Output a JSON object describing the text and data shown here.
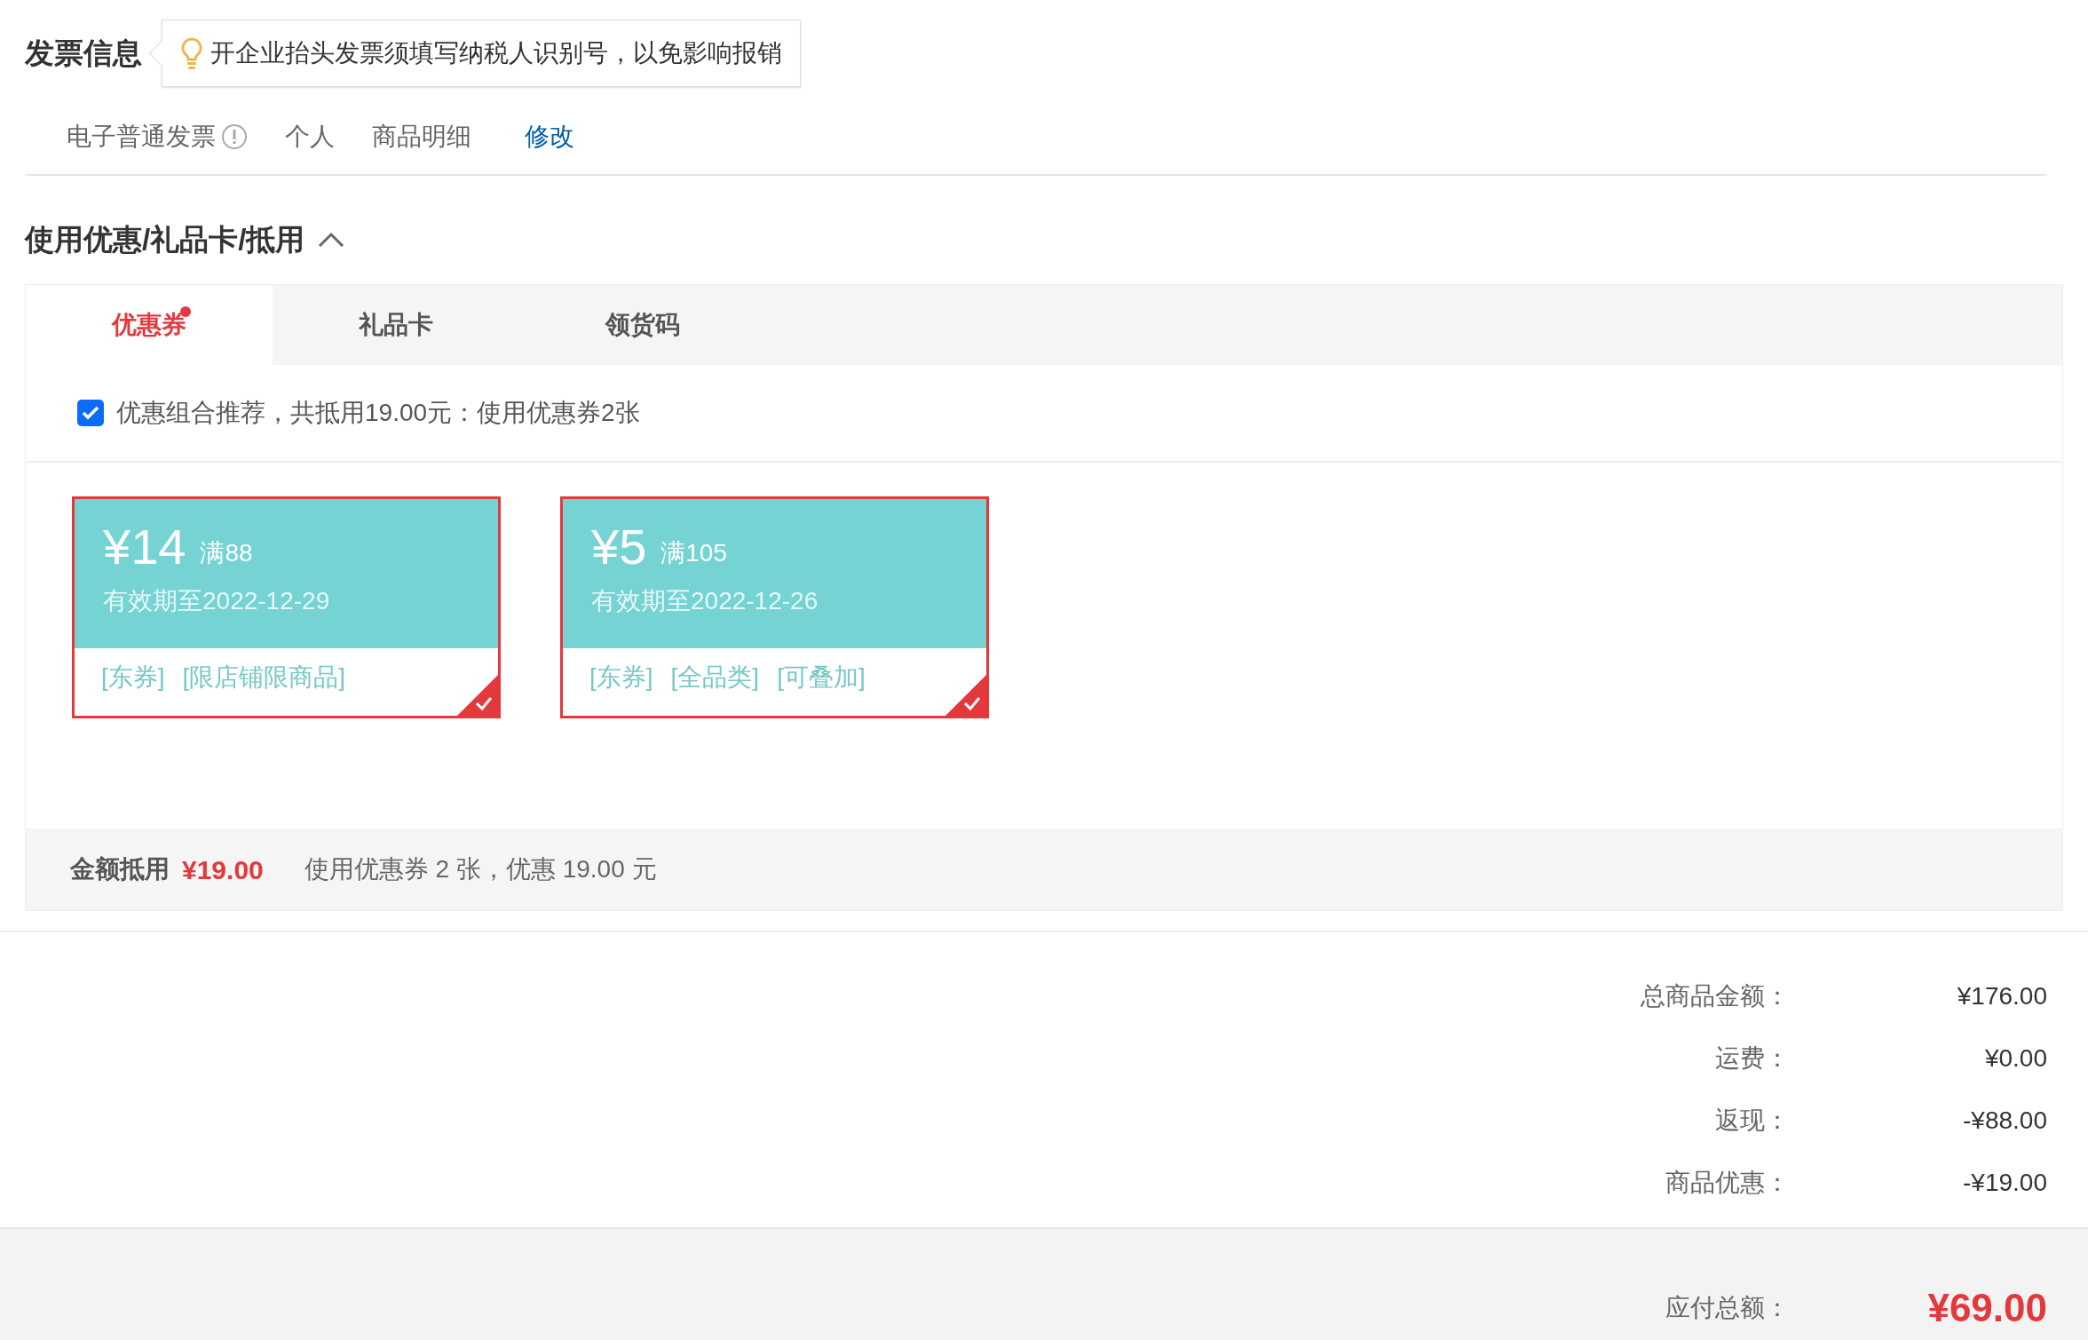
{
  "invoice": {
    "title": "发票信息",
    "tip": "开企业抬头发票须填写纳税人识别号，以免影响报销",
    "items": [
      {
        "kind": "info",
        "text": "电子普通发票"
      },
      {
        "kind": "plain",
        "text": "个人"
      },
      {
        "kind": "plain",
        "text": "商品明细"
      }
    ],
    "edit_link": "修改"
  },
  "discount": {
    "title": "使用优惠/礼品卡/抵用",
    "expanded": true,
    "tabs": [
      {
        "label": "优惠券",
        "selected": true,
        "dot": true
      },
      {
        "label": "礼品卡",
        "selected": false,
        "dot": false
      },
      {
        "label": "领货码",
        "selected": false,
        "dot": false
      }
    ],
    "recommend": {
      "checked": true,
      "text": "优惠组合推荐，共抵用19.00元：使用优惠券2张"
    },
    "coupons": [
      {
        "amount": "¥14",
        "condition": "满88",
        "validity": "有效期至2022-12-29",
        "tags": [
          "[东券]",
          "[限店铺限商品]"
        ],
        "selected": true
      },
      {
        "amount": "¥5",
        "condition": "满105",
        "validity": "有效期至2022-12-26",
        "tags": [
          "[东券]",
          "[全品类]",
          "[可叠加]"
        ],
        "selected": true
      }
    ],
    "footer": {
      "label": "金额抵用",
      "amount": "¥19.00",
      "note": "使用优惠券 2 张，优惠 19.00 元"
    }
  },
  "summary": {
    "rows": [
      {
        "label": "总商品金额：",
        "value": "¥176.00"
      },
      {
        "label": "运费：",
        "value": "¥0.00"
      },
      {
        "label": "返现：",
        "value": "-¥88.00"
      },
      {
        "label": "商品优惠：",
        "value": "-¥19.00"
      }
    ],
    "total": {
      "label": "应付总额：",
      "value": "¥69.00"
    }
  }
}
